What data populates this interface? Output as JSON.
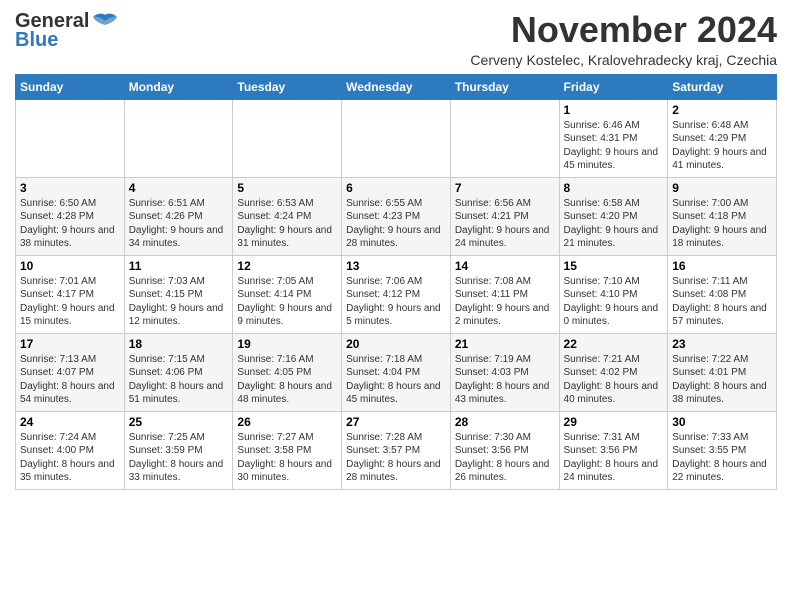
{
  "logo": {
    "line1": "General",
    "line2": "Blue"
  },
  "title": "November 2024",
  "subtitle": "Cerveny Kostelec, Kralovehradecky kraj, Czechia",
  "days_of_week": [
    "Sunday",
    "Monday",
    "Tuesday",
    "Wednesday",
    "Thursday",
    "Friday",
    "Saturday"
  ],
  "weeks": [
    [
      {
        "day": "",
        "info": ""
      },
      {
        "day": "",
        "info": ""
      },
      {
        "day": "",
        "info": ""
      },
      {
        "day": "",
        "info": ""
      },
      {
        "day": "",
        "info": ""
      },
      {
        "day": "1",
        "info": "Sunrise: 6:46 AM\nSunset: 4:31 PM\nDaylight: 9 hours and 45 minutes."
      },
      {
        "day": "2",
        "info": "Sunrise: 6:48 AM\nSunset: 4:29 PM\nDaylight: 9 hours and 41 minutes."
      }
    ],
    [
      {
        "day": "3",
        "info": "Sunrise: 6:50 AM\nSunset: 4:28 PM\nDaylight: 9 hours and 38 minutes."
      },
      {
        "day": "4",
        "info": "Sunrise: 6:51 AM\nSunset: 4:26 PM\nDaylight: 9 hours and 34 minutes."
      },
      {
        "day": "5",
        "info": "Sunrise: 6:53 AM\nSunset: 4:24 PM\nDaylight: 9 hours and 31 minutes."
      },
      {
        "day": "6",
        "info": "Sunrise: 6:55 AM\nSunset: 4:23 PM\nDaylight: 9 hours and 28 minutes."
      },
      {
        "day": "7",
        "info": "Sunrise: 6:56 AM\nSunset: 4:21 PM\nDaylight: 9 hours and 24 minutes."
      },
      {
        "day": "8",
        "info": "Sunrise: 6:58 AM\nSunset: 4:20 PM\nDaylight: 9 hours and 21 minutes."
      },
      {
        "day": "9",
        "info": "Sunrise: 7:00 AM\nSunset: 4:18 PM\nDaylight: 9 hours and 18 minutes."
      }
    ],
    [
      {
        "day": "10",
        "info": "Sunrise: 7:01 AM\nSunset: 4:17 PM\nDaylight: 9 hours and 15 minutes."
      },
      {
        "day": "11",
        "info": "Sunrise: 7:03 AM\nSunset: 4:15 PM\nDaylight: 9 hours and 12 minutes."
      },
      {
        "day": "12",
        "info": "Sunrise: 7:05 AM\nSunset: 4:14 PM\nDaylight: 9 hours and 9 minutes."
      },
      {
        "day": "13",
        "info": "Sunrise: 7:06 AM\nSunset: 4:12 PM\nDaylight: 9 hours and 5 minutes."
      },
      {
        "day": "14",
        "info": "Sunrise: 7:08 AM\nSunset: 4:11 PM\nDaylight: 9 hours and 2 minutes."
      },
      {
        "day": "15",
        "info": "Sunrise: 7:10 AM\nSunset: 4:10 PM\nDaylight: 9 hours and 0 minutes."
      },
      {
        "day": "16",
        "info": "Sunrise: 7:11 AM\nSunset: 4:08 PM\nDaylight: 8 hours and 57 minutes."
      }
    ],
    [
      {
        "day": "17",
        "info": "Sunrise: 7:13 AM\nSunset: 4:07 PM\nDaylight: 8 hours and 54 minutes."
      },
      {
        "day": "18",
        "info": "Sunrise: 7:15 AM\nSunset: 4:06 PM\nDaylight: 8 hours and 51 minutes."
      },
      {
        "day": "19",
        "info": "Sunrise: 7:16 AM\nSunset: 4:05 PM\nDaylight: 8 hours and 48 minutes."
      },
      {
        "day": "20",
        "info": "Sunrise: 7:18 AM\nSunset: 4:04 PM\nDaylight: 8 hours and 45 minutes."
      },
      {
        "day": "21",
        "info": "Sunrise: 7:19 AM\nSunset: 4:03 PM\nDaylight: 8 hours and 43 minutes."
      },
      {
        "day": "22",
        "info": "Sunrise: 7:21 AM\nSunset: 4:02 PM\nDaylight: 8 hours and 40 minutes."
      },
      {
        "day": "23",
        "info": "Sunrise: 7:22 AM\nSunset: 4:01 PM\nDaylight: 8 hours and 38 minutes."
      }
    ],
    [
      {
        "day": "24",
        "info": "Sunrise: 7:24 AM\nSunset: 4:00 PM\nDaylight: 8 hours and 35 minutes."
      },
      {
        "day": "25",
        "info": "Sunrise: 7:25 AM\nSunset: 3:59 PM\nDaylight: 8 hours and 33 minutes."
      },
      {
        "day": "26",
        "info": "Sunrise: 7:27 AM\nSunset: 3:58 PM\nDaylight: 8 hours and 30 minutes."
      },
      {
        "day": "27",
        "info": "Sunrise: 7:28 AM\nSunset: 3:57 PM\nDaylight: 8 hours and 28 minutes."
      },
      {
        "day": "28",
        "info": "Sunrise: 7:30 AM\nSunset: 3:56 PM\nDaylight: 8 hours and 26 minutes."
      },
      {
        "day": "29",
        "info": "Sunrise: 7:31 AM\nSunset: 3:56 PM\nDaylight: 8 hours and 24 minutes."
      },
      {
        "day": "30",
        "info": "Sunrise: 7:33 AM\nSunset: 3:55 PM\nDaylight: 8 hours and 22 minutes."
      }
    ]
  ]
}
